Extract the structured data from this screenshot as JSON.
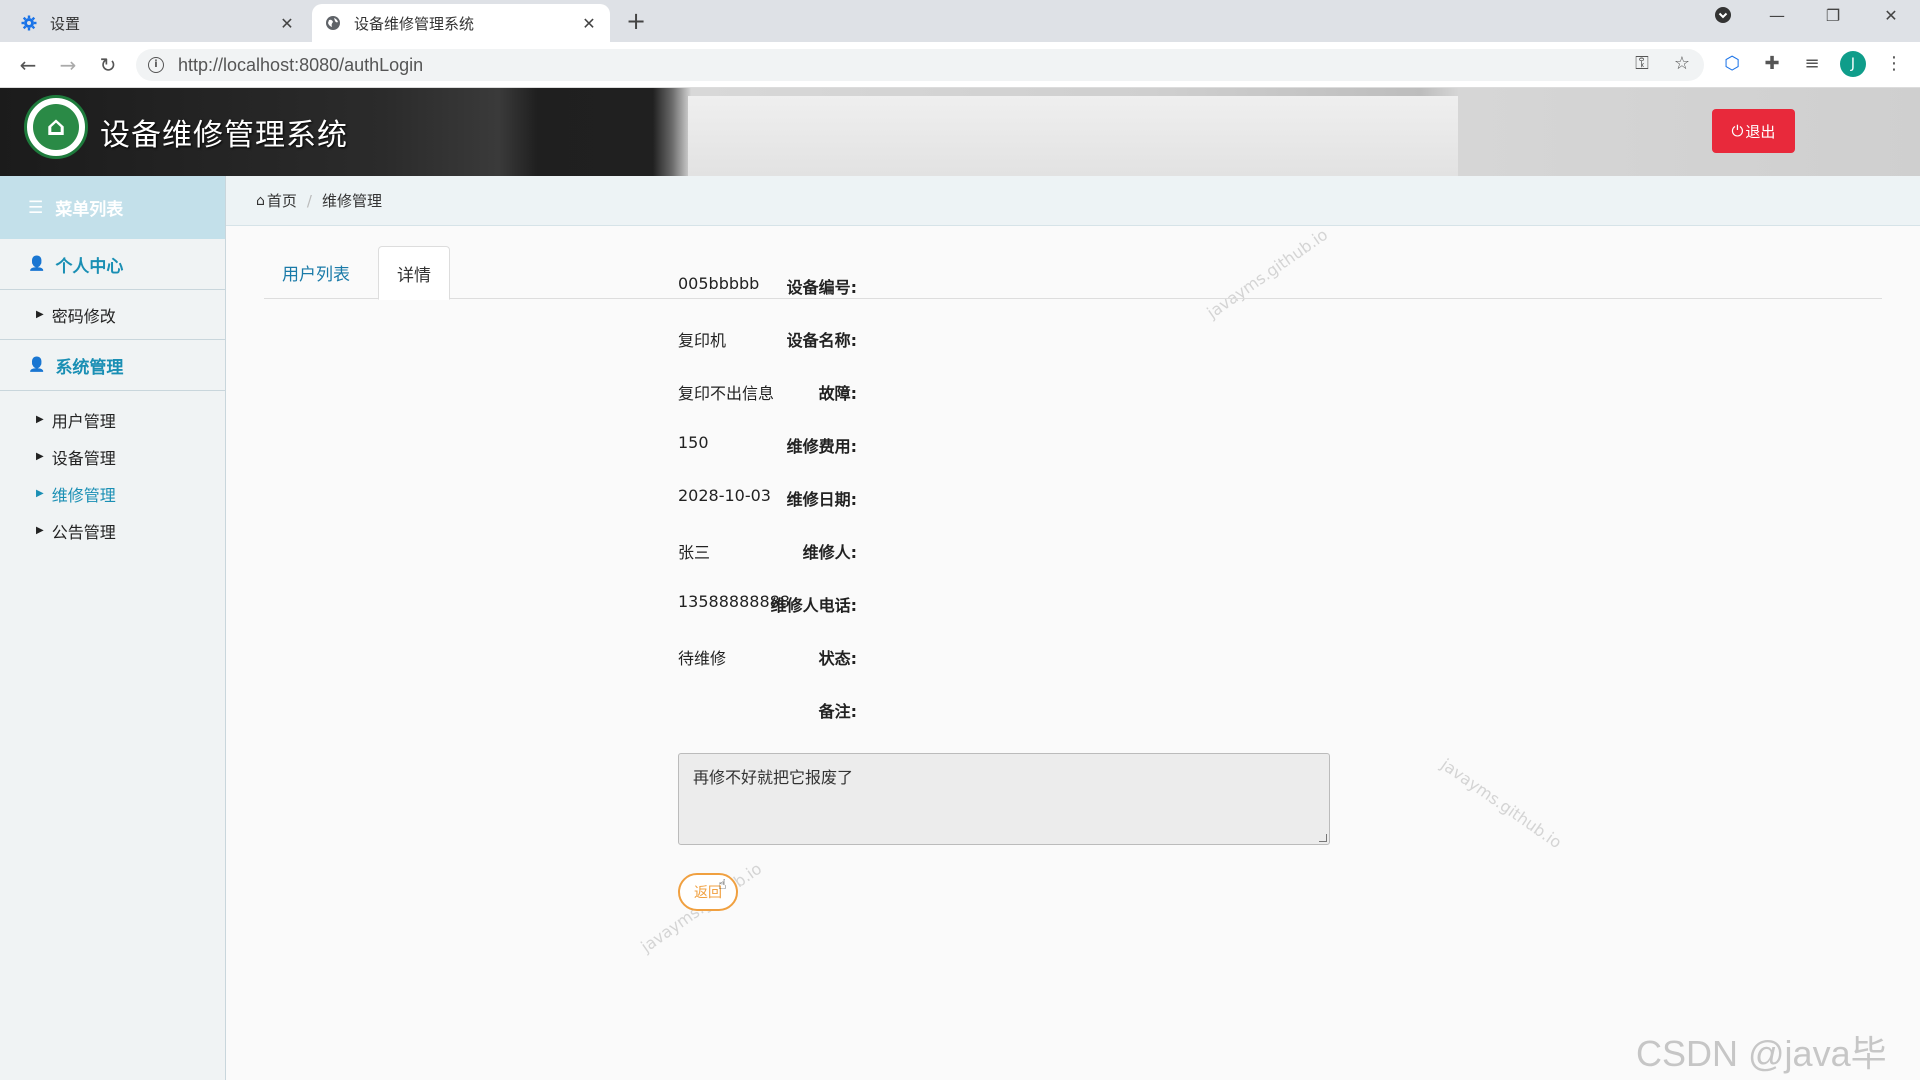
{
  "browser": {
    "tabs": [
      {
        "title": "设置",
        "icon": "gear-icon",
        "close": "✕"
      },
      {
        "title": "设备维修管理系统",
        "icon": "globe-icon",
        "close": "✕"
      }
    ],
    "new_tab": "+",
    "url": "http://localhost:8080/authLogin",
    "profile_initial": "J"
  },
  "header": {
    "title": "设备维修管理系统",
    "logout_label": "退出"
  },
  "sidebar": {
    "menu_title": "菜单列表",
    "sections": [
      {
        "title": "个人中心",
        "items": [
          {
            "label": "密码修改"
          }
        ]
      },
      {
        "title": "系统管理",
        "items": [
          {
            "label": "用户管理"
          },
          {
            "label": "设备管理"
          },
          {
            "label": "维修管理",
            "active": true
          },
          {
            "label": "公告管理"
          }
        ]
      }
    ]
  },
  "breadcrumb": {
    "home": "首页",
    "current": "维修管理"
  },
  "tabs": [
    {
      "label": "用户列表"
    },
    {
      "label": "详情"
    }
  ],
  "detail": {
    "fields": [
      {
        "label": "设备编号:",
        "value": "005bbbbb"
      },
      {
        "label": "设备名称:",
        "value": "复印机"
      },
      {
        "label": "故障:",
        "value": "复印不出信息"
      },
      {
        "label": "维修费用:",
        "value": "150"
      },
      {
        "label": "维修日期:",
        "value": "2028-10-03"
      },
      {
        "label": "维修人:",
        "value": "张三"
      },
      {
        "label": "维修人电话:",
        "value": "13588888888"
      },
      {
        "label": "状态:",
        "value": "待维修"
      }
    ],
    "remark_label": "备注:",
    "remark_value": "再修不好就把它报废了",
    "back_label": "返回"
  },
  "watermark": "javayms.github.io",
  "csdn_watermark": "CSDN @java毕业",
  "colors": {
    "accent": "#1a8fb4",
    "danger": "#e8293b",
    "warning": "#f0a040"
  }
}
